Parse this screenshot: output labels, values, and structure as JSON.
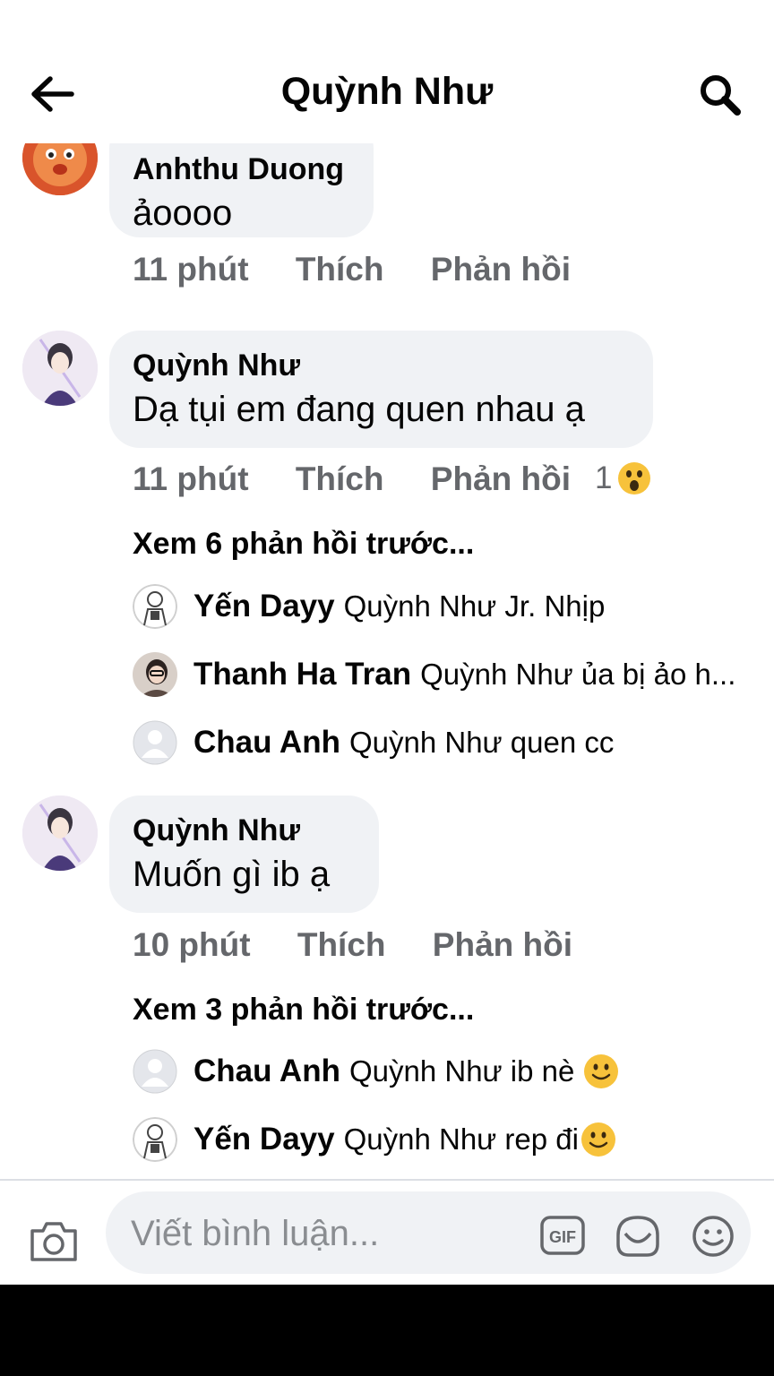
{
  "header": {
    "title": "Quỳnh Như"
  },
  "comments": [
    {
      "author": "Anhthu Duong",
      "text": "ảoooo",
      "time": "11 phút",
      "like_label": "Thích",
      "reply_label": "Phản hồi"
    },
    {
      "author": "Quỳnh Như",
      "text": "Dạ tụi em đang quen nhau ạ",
      "time": "11 phút",
      "like_label": "Thích",
      "reply_label": "Phản hồi",
      "reaction_count": "1",
      "reaction_icon": "wow-emoji-icon",
      "view_more": "Xem 6 phản hồi trước...",
      "replies": [
        {
          "name": "Yến Dayy",
          "text": "Quỳnh Như Jr. Nhịp"
        },
        {
          "name": "Thanh Ha Tran",
          "text": "Quỳnh Như ủa bị ảo h..."
        },
        {
          "name": "Chau Anh",
          "text": "Quỳnh Như quen cc"
        }
      ]
    },
    {
      "author": "Quỳnh Như",
      "text": "Muốn gì ib ạ",
      "time": "10 phút",
      "like_label": "Thích",
      "reply_label": "Phản hồi",
      "view_more": "Xem 3 phản hồi trước...",
      "replies": [
        {
          "name": "Chau Anh",
          "text": "Quỳnh Như ib nè",
          "emoji": "smile-emoji-icon"
        },
        {
          "name": "Yến Dayy",
          "text": "Quỳnh Như rep đi",
          "emoji": "smile-emoji-icon"
        }
      ]
    }
  ],
  "composer": {
    "placeholder": "Viết bình luận..."
  },
  "colors": {
    "bubble": "#f0f2f5",
    "meta_text": "#65676b",
    "primary_text": "#050505",
    "divider": "#dcdfe4"
  }
}
